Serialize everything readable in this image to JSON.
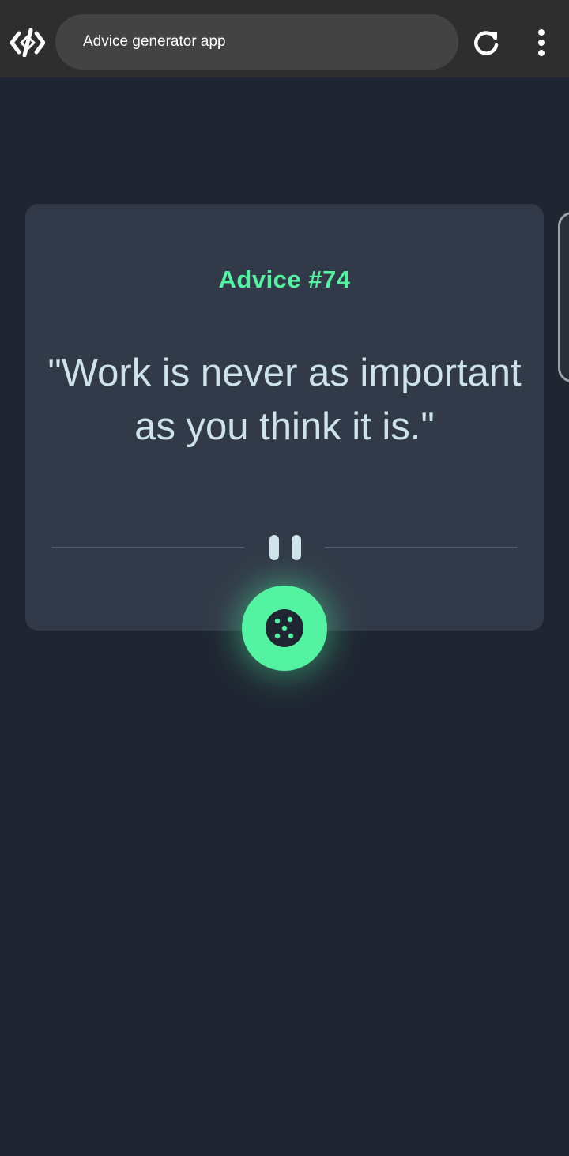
{
  "browser": {
    "url_text": "Advice generator app",
    "logo_icon": "code-brackets-icon",
    "reload_icon": "reload-icon",
    "menu_icon": "more-vert-icon"
  },
  "advice": {
    "id_label": "Advice #74",
    "text": "\"Work is never as important as you think it is.\""
  },
  "controls": {
    "generate_icon": "dice-icon"
  },
  "colors": {
    "background": "#1f2632",
    "card": "#323a49",
    "accent": "#53f3a1",
    "quote_text": "#cee3e9",
    "divider": "#4f5d74",
    "toolbar": "#2e2e2e",
    "url_pill": "#434343"
  }
}
